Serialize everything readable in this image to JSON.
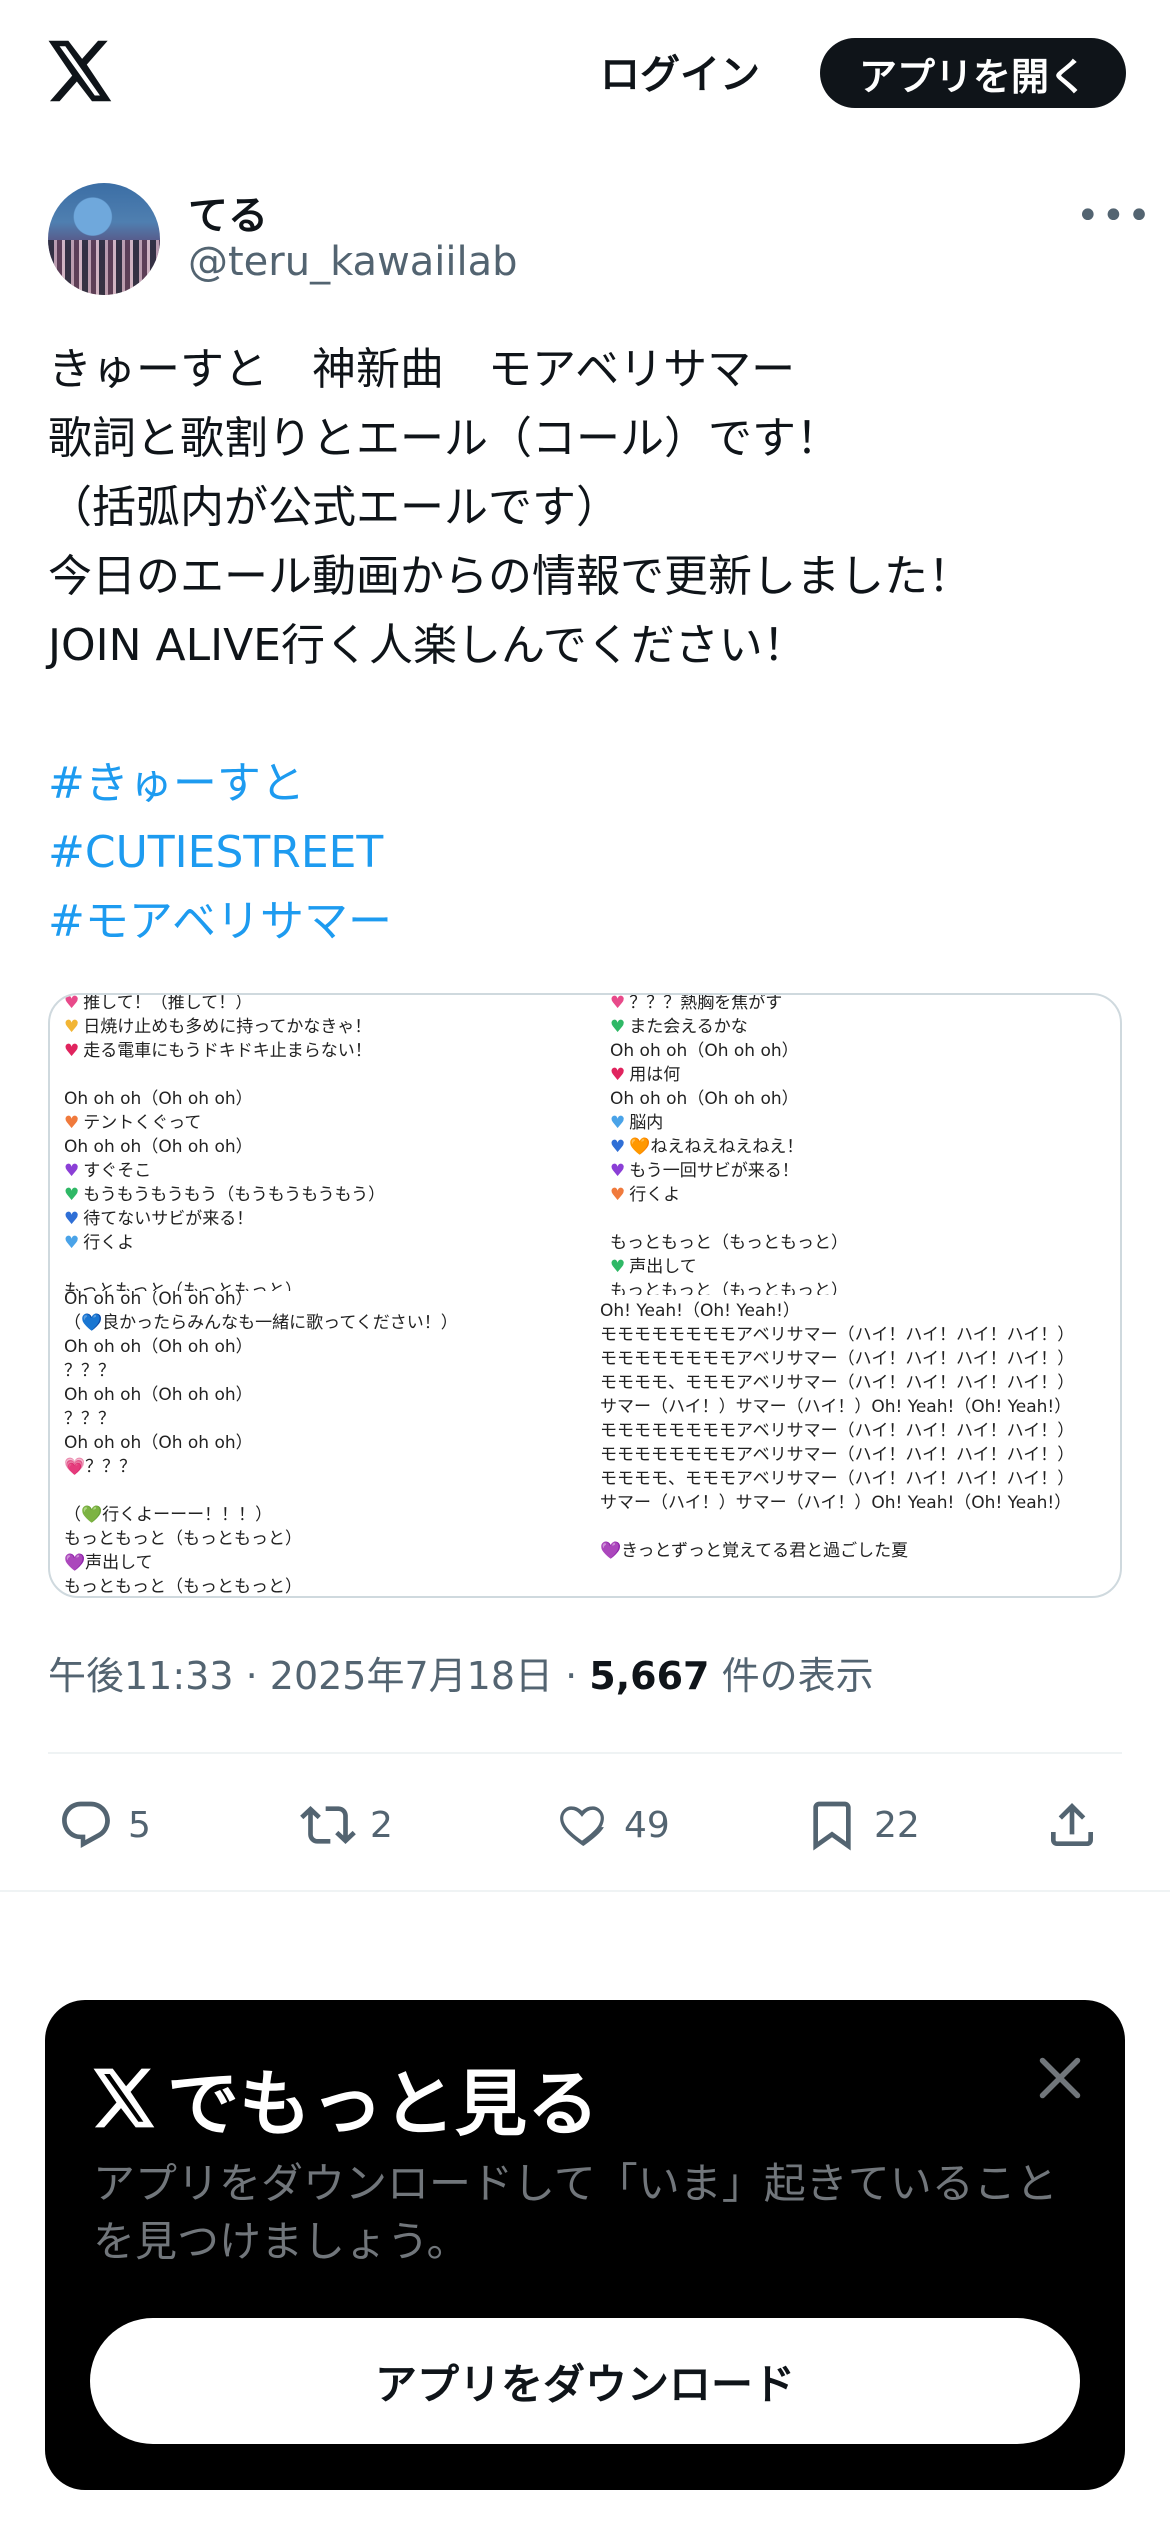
{
  "header": {
    "logo_icon": "x-logo-icon",
    "login_label": "ログイン",
    "open_app_label": "アプリを開く"
  },
  "author": {
    "display_name": "てる",
    "handle": "@teru_kawaiilab",
    "more_icon": "more-horizontal-icon"
  },
  "tweet": {
    "lines": [
      "きゅーすと　神新曲　モアベリサマー",
      "歌詞と歌割りとエール（コール）です！",
      "（括弧内が公式エールです）",
      "今日のエール動画からの情報で更新しました！",
      "JOIN ALIVE行く人楽しんでください！"
    ],
    "hashtags": [
      "#きゅーすと",
      "#CUTIESTREET",
      "#モアベリサマー"
    ],
    "time": "午後11:33",
    "date": "2025年7月18日",
    "views_count": "5,667",
    "views_label": "件の表示"
  },
  "media": {
    "top_left": [
      {
        "h": "#e84a8a",
        "t": "推して！（推して！）"
      },
      {
        "h": "#f2b534",
        "t": "日焼け止めも多めに持ってかなきゃ！"
      },
      {
        "h": "#e0245e",
        "t": "走る電車にもうドキドキ止まらない！"
      },
      {
        "h": "",
        "t": ""
      },
      {
        "h": "",
        "t": "Oh oh oh（Oh oh oh）"
      },
      {
        "h": "#f07a3c",
        "t": "テントくぐって"
      },
      {
        "h": "",
        "t": "Oh oh oh（Oh oh oh）"
      },
      {
        "h": "#8b3fd6",
        "t": "すぐそこ"
      },
      {
        "h": "#2fb866",
        "t": "もうもうもうもう（もうもうもうもう）"
      },
      {
        "h": "#2f6fd6",
        "t": "待てないサビが来る！"
      },
      {
        "h": "#4aa3e8",
        "t": "行くよ"
      },
      {
        "h": "",
        "t": ""
      },
      {
        "h": "",
        "t": "もっともっと（もっともっと）"
      }
    ],
    "bottom_left": [
      "Oh oh oh（Oh oh oh）",
      "（💙良かったらみんなも一緒に歌ってください！）",
      "Oh oh oh（Oh oh oh）",
      "？？？",
      "Oh oh oh（Oh oh oh）",
      "？？？",
      "Oh oh oh（Oh oh oh）",
      "💗？？？",
      "",
      "（💚行くよーーー！！！）",
      "もっともっと（もっともっと）",
      "💜声出して",
      "もっともっと（もっともっと）"
    ],
    "top_right": [
      {
        "h": "#e84a8a",
        "t": "？？？熱胸を焦がす"
      },
      {
        "h": "#2fb866",
        "t": "また会えるかな"
      },
      {
        "h": "",
        "t": "Oh oh oh（Oh oh oh）"
      },
      {
        "h": "#e0245e",
        "t": "用は何"
      },
      {
        "h": "",
        "t": "Oh oh oh（Oh oh oh）"
      },
      {
        "h": "#4aa3e8",
        "t": "脳内"
      },
      {
        "h": "#2f6fd6",
        "t": "🧡ねえねえねえねえ！"
      },
      {
        "h": "#8b3fd6",
        "t": "もう一回サビが来る！"
      },
      {
        "h": "#f07a3c",
        "t": "行くよ"
      },
      {
        "h": "",
        "t": ""
      },
      {
        "h": "",
        "t": "もっともっと（もっともっと）"
      },
      {
        "h": "#2fb866",
        "t": "声出して"
      },
      {
        "h": "",
        "t": "もっともっと（もっともっと）"
      }
    ],
    "bottom_right": [
      "Oh! Yeah!（Oh! Yeah!）",
      "モモモモモモモモアベリサマー（ハイ！ハイ！ハイ！ハイ！）",
      "モモモモモモモモアベリサマー（ハイ！ハイ！ハイ！ハイ！）",
      "モモモモ、モモモアベリサマー（ハイ！ハイ！ハイ！ハイ！）",
      "サマー（ハイ！）サマー（ハイ！）Oh! Yeah!（Oh! Yeah!）",
      "モモモモモモモモアベリサマー（ハイ！ハイ！ハイ！ハイ！）",
      "モモモモモモモモアベリサマー（ハイ！ハイ！ハイ！ハイ！）",
      "モモモモ、モモモアベリサマー（ハイ！ハイ！ハイ！ハイ！）",
      "サマー（ハイ！）サマー（ハイ！）Oh! Yeah!（Oh! Yeah!）",
      "",
      "💜きっとずっと覚えてる君と過ごした夏"
    ]
  },
  "actions": {
    "reply_count": "5",
    "retweet_count": "2",
    "like_count": "49",
    "bookmark_count": "22"
  },
  "promo": {
    "title": "でもっと見る",
    "description": "アプリをダウンロードして「いま」起きていることを見つけましょう。",
    "download_label": "アプリをダウンロード"
  }
}
